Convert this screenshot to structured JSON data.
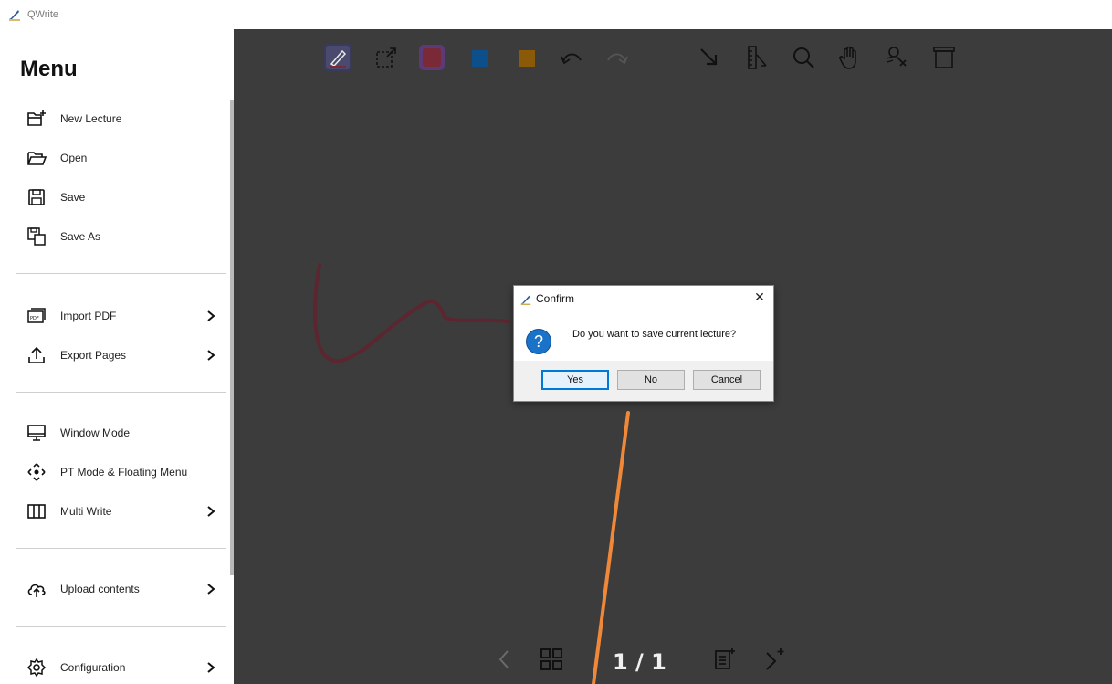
{
  "app": {
    "title": "QWrite"
  },
  "menu": {
    "title": "Menu",
    "groups": [
      [
        {
          "label": "New Lecture",
          "icon": "new-folder-icon",
          "submenu": false
        },
        {
          "label": "Open",
          "icon": "open-folder-icon",
          "submenu": false
        },
        {
          "label": "Save",
          "icon": "save-icon",
          "submenu": false
        },
        {
          "label": "Save As",
          "icon": "save-as-icon",
          "submenu": false
        }
      ],
      [
        {
          "label": "Import PDF",
          "icon": "pdf-icon",
          "submenu": true
        },
        {
          "label": "Export Pages",
          "icon": "export-icon",
          "submenu": true
        }
      ],
      [
        {
          "label": "Window Mode",
          "icon": "monitor-icon",
          "submenu": false
        },
        {
          "label": "PT Mode & Floating Menu",
          "icon": "move-arrows-icon",
          "submenu": false
        },
        {
          "label": "Multi Write",
          "icon": "columns-icon",
          "submenu": true
        }
      ],
      [
        {
          "label": "Upload contents",
          "icon": "cloud-upload-icon",
          "submenu": true
        }
      ],
      [
        {
          "label": "Configuration",
          "icon": "gear-icon",
          "submenu": true
        }
      ]
    ]
  },
  "toolbar": {
    "tools": [
      {
        "name": "pen-tool",
        "icon": "pen-icon",
        "active": true
      },
      {
        "name": "select-tool",
        "icon": "selection-icon"
      },
      {
        "name": "color-red",
        "icon": "color-swatch",
        "color": "#7a2a36",
        "active": true
      },
      {
        "name": "color-blue",
        "icon": "color-swatch",
        "color": "#0d4f8a"
      },
      {
        "name": "color-orange",
        "icon": "color-swatch",
        "color": "#8a5a08"
      },
      {
        "name": "undo",
        "icon": "undo-icon"
      },
      {
        "name": "redo",
        "icon": "redo-icon"
      },
      {
        "name": "arrow-tool",
        "icon": "arrow-icon"
      },
      {
        "name": "ruler-tool",
        "icon": "ruler-icon"
      },
      {
        "name": "zoom-tool",
        "icon": "magnifier-icon"
      },
      {
        "name": "pan-tool",
        "icon": "hand-icon"
      },
      {
        "name": "laser-tool",
        "icon": "laser-pointer-icon"
      },
      {
        "name": "board-tool",
        "icon": "whiteboard-icon"
      }
    ]
  },
  "navigation": {
    "page_indicator": "1 / 1",
    "prev_icon": "chevron-left-icon",
    "grid_icon": "grid-icon",
    "add_page_icon": "add-page-icon",
    "next_icon": "chevron-right-plus-icon"
  },
  "dialog": {
    "title": "Confirm",
    "message": "Do you want to save current lecture?",
    "buttons": {
      "yes": "Yes",
      "no": "No",
      "cancel": "Cancel"
    }
  },
  "colors": {
    "canvas_bg": "#3c3c3c",
    "stroke": "#5b2630",
    "annotation": "#f0883a",
    "dialog_accent": "#0078d7"
  }
}
